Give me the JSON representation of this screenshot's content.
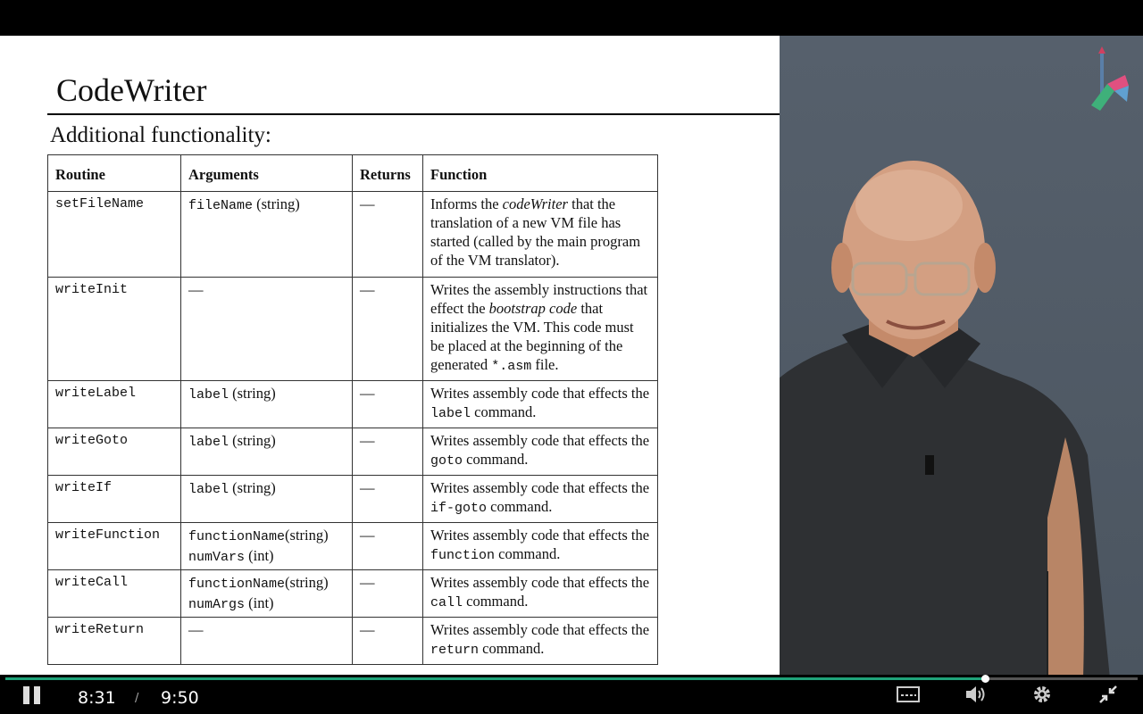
{
  "slide": {
    "title": "CodeWriter",
    "subtitle": "Additional functionality:",
    "headers": [
      "Routine",
      "Arguments",
      "Returns",
      "Function"
    ],
    "rows": [
      {
        "routine": "setFileName",
        "args": [
          {
            "code": "fileName",
            "rest": " (string)"
          }
        ],
        "returns": "—",
        "func": [
          {
            "t": "Informs the "
          },
          {
            "t": "codeWriter",
            "i": true
          },
          {
            "t": " that the translation of a new VM file has started (called by the main program of the VM translator)."
          }
        ]
      },
      {
        "routine": "writeInit",
        "args": [
          {
            "code": "",
            "rest": "—"
          }
        ],
        "returns": "—",
        "func": [
          {
            "t": "Writes the assembly instructions that effect the "
          },
          {
            "t": "bootstrap code",
            "i": true
          },
          {
            "t": " that initializes the VM. This code must be placed at the beginning of the generated "
          },
          {
            "t": "*.asm",
            "m": true
          },
          {
            "t": " file."
          }
        ]
      },
      {
        "routine": "writeLabel",
        "args": [
          {
            "code": "label",
            "rest": " (string)"
          }
        ],
        "returns": "—",
        "func": [
          {
            "t": "Writes assembly code that effects the "
          },
          {
            "t": "label",
            "m": true
          },
          {
            "t": " command."
          }
        ]
      },
      {
        "routine": "writeGoto",
        "args": [
          {
            "code": "label",
            "rest": " (string)"
          }
        ],
        "returns": "—",
        "func": [
          {
            "t": "Writes assembly code that effects the "
          },
          {
            "t": "goto",
            "m": true
          },
          {
            "t": " command."
          }
        ]
      },
      {
        "routine": "writeIf",
        "args": [
          {
            "code": "label",
            "rest": " (string)"
          }
        ],
        "returns": "—",
        "func": [
          {
            "t": "Writes assembly code that effects the "
          },
          {
            "t": "if-goto",
            "m": true
          },
          {
            "t": " command."
          }
        ]
      },
      {
        "routine": "writeFunction",
        "args": [
          {
            "code": "functionName",
            "rest": "(string)"
          },
          {
            "code": "numVars",
            "rest": " (int)"
          }
        ],
        "returns": "—",
        "func": [
          {
            "t": "Writes assembly code that effects the "
          },
          {
            "t": "function",
            "m": true
          },
          {
            "t": " command."
          }
        ]
      },
      {
        "routine": "writeCall",
        "args": [
          {
            "code": "functionName",
            "rest": "(string)"
          },
          {
            "code": "numArgs",
            "rest": " (int)"
          }
        ],
        "returns": "—",
        "func": [
          {
            "t": "Writes assembly code that effects the "
          },
          {
            "t": "call",
            "m": true
          },
          {
            "t": " command."
          }
        ]
      },
      {
        "routine": "writeReturn",
        "args": [
          {
            "code": "",
            "rest": "—"
          }
        ],
        "returns": "—",
        "func": [
          {
            "t": "Writes assembly code that effects the "
          },
          {
            "t": "return",
            "m": true
          },
          {
            "t": " command."
          }
        ]
      }
    ]
  },
  "player": {
    "current_time": "8:31",
    "separator": "/",
    "duration": "9:50",
    "progress": 0.865,
    "accent": "#1fa37a",
    "icons": [
      "pause-icon",
      "captions-icon",
      "volume-icon",
      "settings-icon",
      "exit-fullscreen-icon"
    ]
  },
  "presenter": {
    "icon": "instructor-video",
    "logo_icon": "course-logo-icon"
  }
}
